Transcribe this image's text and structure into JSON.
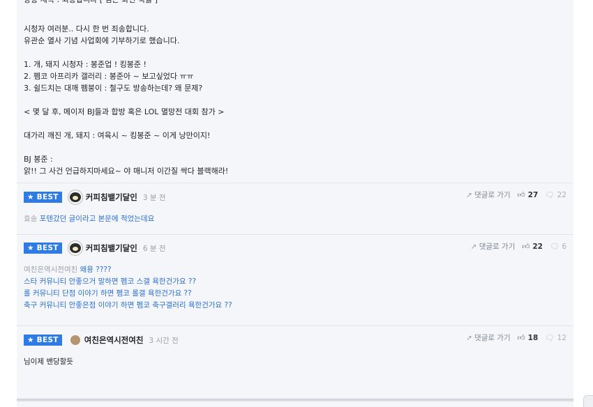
{
  "post": {
    "lines": [
      "방송 제목 : 죄송합니다 [ 검은 화면 국률 ]",
      "",
      "시청자 여러분.. 다시 한 번 죄송합니다.",
      "유관순 열사 기념 사업회에 기부하기로 했습니다.",
      "",
      "1. 개, 돼지 시청자 : 봉준업 ! 킹봉준 !",
      "2. 펨코 아프리카 갤러리 : 봉준아 ~ 보고싶었다 ㅠㅠ",
      "3. 쉴드치는 대깨 펨붕이 : 철구도 방송하는데? 왜 문제?",
      "",
      "< 몇 달 후, 메이저 BJ들과 합방 혹은 LOL 멸망전 대회 참가 >",
      "",
      "대가리 깨진 개, 돼지 : 여육시 ~ 킹봉준 ~ 이게 낭만이지!",
      "",
      "BJ 봉준 :",
      "앍!! 그 사건 언급하지마세요~ 야 매니저 이간질 싹다 블랙해라!"
    ]
  },
  "comments": [
    {
      "badge": "★ BEST",
      "avatar": "bear-avatar",
      "nickname": "커피침뱉기달인",
      "time": "3 분 전",
      "reply_label": "댓글로 가기",
      "likes": "27",
      "comment_count": "22",
      "body": [
        {
          "prefix": "효송",
          "text": "포텐갔던 글이라고 본문에 적었는데요"
        }
      ]
    },
    {
      "badge": "★ BEST",
      "avatar": "bear-avatar",
      "nickname": "커피침뱉기달인",
      "time": "6 분 전",
      "reply_label": "댓글로 가기",
      "likes": "22",
      "comment_count": "6",
      "body": [
        {
          "prefix": "여친은역시전여친",
          "text": "왜용 ????"
        },
        {
          "prefix": "",
          "text": "스타 커뮤니티 안좋으거 말하면 펨코 스갤 욕한건가요 ??"
        },
        {
          "prefix": "",
          "text": "롤 커뮤니티 단점 이야기 하면 펨코 롤갤 욕한건가요 ??"
        },
        {
          "prefix": "",
          "text": "축구 커뮤니티 안좋은점 이야기 하면 펨코 축구갤러리 욕한건가요 ??"
        }
      ]
    },
    {
      "badge": "★ BEST",
      "avatar": "dot-avatar",
      "nickname": "여친은역시전여친",
      "time": "3 시간 전",
      "reply_label": "댓글로 가기",
      "likes": "18",
      "comment_count": "12",
      "body": [
        {
          "prefix": "",
          "text": "님이제 밴당할듯"
        }
      ]
    }
  ],
  "icons": {
    "reply": "reply-arrow-icon",
    "like": "thumbs-up-icon",
    "comments": "speech-bubble-icon"
  },
  "colors": {
    "best_badge": "#2f7be6",
    "link_text": "#2b6fd0",
    "page_bg": "#f5f6fa"
  }
}
